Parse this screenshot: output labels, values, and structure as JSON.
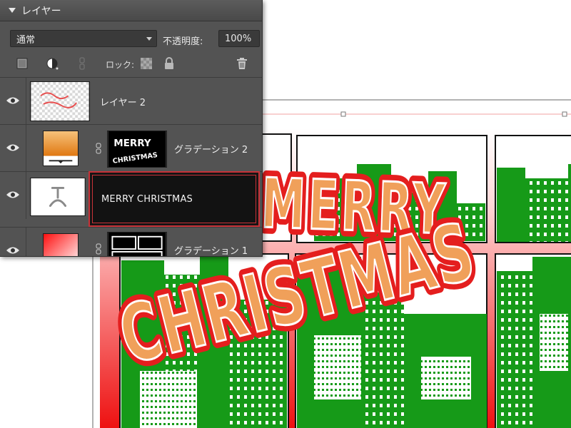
{
  "panel": {
    "title": "レイヤー",
    "blend_mode": "通常",
    "opacity_label": "不透明度:",
    "opacity_value": "100%",
    "lock_label": "ロック:"
  },
  "layers": [
    {
      "name": "レイヤー 2",
      "visible": true
    },
    {
      "name": "グラデーション 2",
      "visible": true
    },
    {
      "name": "MERRY CHRISTMAS",
      "visible": true,
      "selected": true,
      "editing_text": "MERRY CHRISTMAS"
    },
    {
      "name": "グラデーション 1",
      "visible": true
    }
  ],
  "thumbnails": {
    "mask_text_line1": "MERRY",
    "mask_text_line2": "CHRISTMAS"
  },
  "artwork": {
    "line1": "MERRY",
    "line2": "CHRISTMAS",
    "text_fill": "#f0a05a",
    "text_outline": "#e41e1e",
    "building_color": "#169a18",
    "frame_gradient_top": "#ffffff",
    "frame_gradient_bottom": "#ee1111"
  },
  "icons": [
    "collapse-arrow-icon",
    "new-layer-icon",
    "adjustment-layer-icon",
    "link-icon",
    "lock-transparency-icon",
    "lock-all-icon",
    "trash-icon",
    "eye-icon",
    "chain-icon",
    "text-layer-icon"
  ]
}
